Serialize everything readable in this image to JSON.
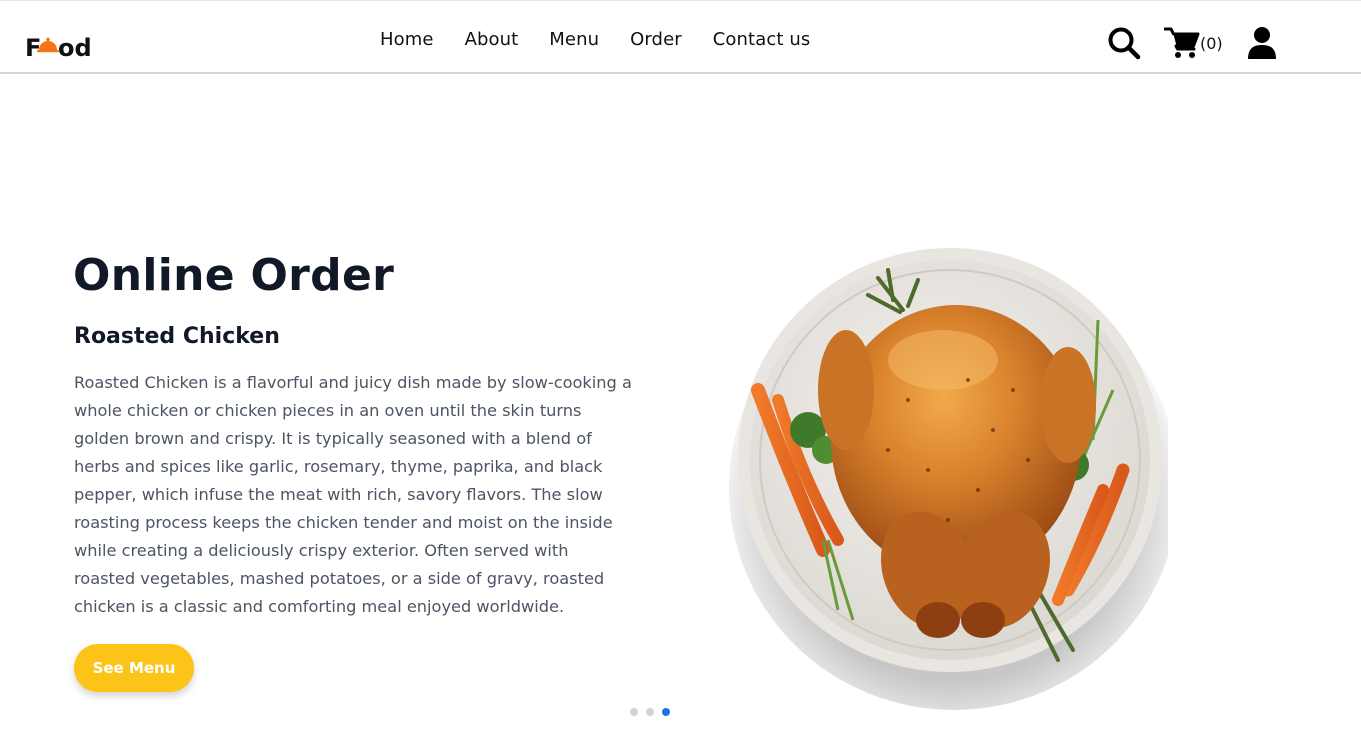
{
  "brand": {
    "logo_text": "Food",
    "accent_color": "#f97316"
  },
  "nav": {
    "items": [
      {
        "label": "Home"
      },
      {
        "label": "About"
      },
      {
        "label": "Menu"
      },
      {
        "label": "Order"
      },
      {
        "label": "Contact us"
      }
    ]
  },
  "header_icons": {
    "search_icon": "search-icon",
    "cart_icon": "cart-icon",
    "cart_count": "(0)",
    "user_icon": "user-icon"
  },
  "hero": {
    "title": "Online Order",
    "subtitle": "Roasted Chicken",
    "description": "Roasted Chicken is a flavorful and juicy dish made by slow-cooking a whole chicken or chicken pieces in an oven until the skin turns golden brown and crispy. It is typically seasoned with a blend of herbs and spices like garlic, rosemary, thyme, paprika, and black pepper, which infuse the meat with rich, savory flavors. The slow roasting process keeps the chicken tender and moist on the inside while creating a deliciously crispy exterior. Often served with roasted vegetables, mashed potatoes, or a side of gravy, roasted chicken is a classic and comforting meal enjoyed worldwide.",
    "cta_label": "See Menu",
    "cta_color": "#fcc419",
    "image": "roasted-chicken-plate"
  },
  "carousel": {
    "slide_count": 3,
    "active_slide": 3,
    "active_color": "#1a73e8"
  }
}
